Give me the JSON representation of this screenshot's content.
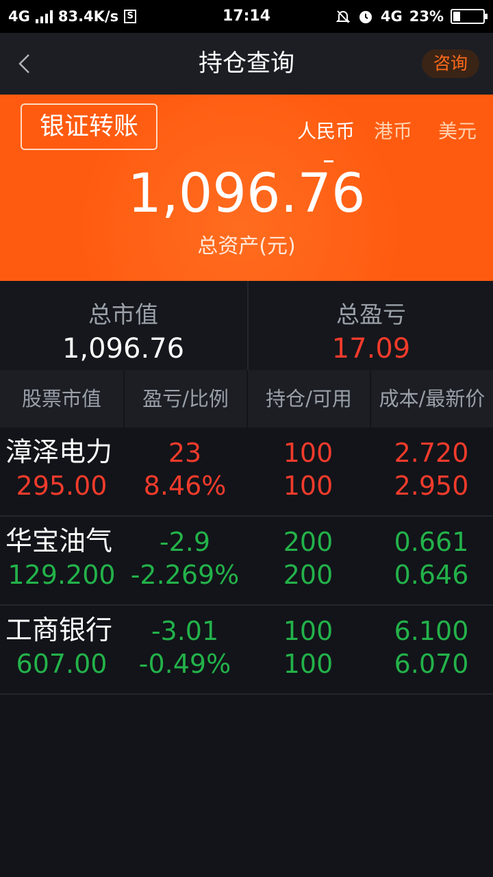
{
  "status_bar": {
    "network": "4G",
    "speed": "83.4K/s",
    "s_badge": "S",
    "time": "17:14",
    "network2": "4G",
    "battery": "23%",
    "battery_level": 0.23
  },
  "nav": {
    "title": "持仓查询",
    "consult_label": "咨询"
  },
  "banner": {
    "transfer_button": "银证转账",
    "currencies": [
      "人民币",
      "港币",
      "美元"
    ],
    "selected_currency": "人民币",
    "total_assets": "1,096.76",
    "total_assets_label": "总资产(元)",
    "colors": {
      "background": "#ff5b10"
    }
  },
  "summary": {
    "market_value_label": "总市值",
    "market_value": "1,096.76",
    "profit_label": "总盈亏",
    "profit": "17.09"
  },
  "table": {
    "headers": [
      "股票市值",
      "盈亏/比例",
      "持仓/可用",
      "成本/最新价"
    ],
    "rows": [
      {
        "name": "漳泽电力",
        "market_value": "295.00",
        "profit": "23",
        "ratio": "8.46%",
        "position": "100",
        "available": "100",
        "cost": "2.720",
        "latest": "2.950",
        "trend": "up"
      },
      {
        "name": "华宝油气",
        "market_value": "129.200",
        "profit": "-2.9",
        "ratio": "-2.269%",
        "position": "200",
        "available": "200",
        "cost": "0.661",
        "latest": "0.646",
        "trend": "down"
      },
      {
        "name": "工商银行",
        "market_value": "607.00",
        "profit": "-3.01",
        "ratio": "-0.49%",
        "position": "100",
        "available": "100",
        "cost": "6.100",
        "latest": "6.070",
        "trend": "down"
      }
    ]
  },
  "colors": {
    "up": "#f23b2c",
    "down": "#23b24a",
    "accent": "#ff6a1a"
  },
  "icons": {
    "back": "chevron-left-icon"
  }
}
